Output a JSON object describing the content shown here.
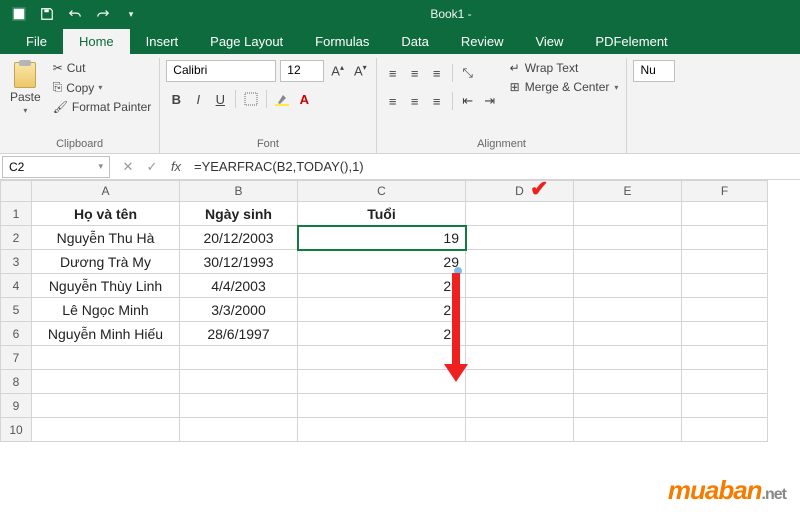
{
  "titlebar": {
    "doc_title": "Book1 -"
  },
  "tabs": [
    "File",
    "Home",
    "Insert",
    "Page Layout",
    "Formulas",
    "Data",
    "Review",
    "View",
    "PDFelement"
  ],
  "active_tab": 1,
  "clipboard": {
    "paste_label": "Paste",
    "cut_label": "Cut",
    "copy_label": "Copy",
    "fp_label": "Format Painter",
    "group_label": "Clipboard"
  },
  "font": {
    "name": "Calibri",
    "size": "12",
    "bold": "B",
    "italic": "I",
    "underline": "U",
    "group_label": "Font"
  },
  "alignment": {
    "wrap_label": "Wrap Text",
    "merge_label": "Merge & Center",
    "group_label": "Alignment"
  },
  "number": {
    "format": "Nu"
  },
  "formula_bar": {
    "name_box": "C2",
    "formula": "=YEARFRAC(B2,TODAY(),1)"
  },
  "columns": [
    "A",
    "B",
    "C",
    "D",
    "E",
    "F"
  ],
  "headers": {
    "A": "Họ và tên",
    "B": "Ngày sinh",
    "C": "Tuổi"
  },
  "rows": [
    {
      "A": "Nguyễn Thu Hà",
      "B": "20/12/2003",
      "C": "19"
    },
    {
      "A": "Dương Trà My",
      "B": "30/12/1993",
      "C": "29"
    },
    {
      "A": "Nguyễn Thùy Linh",
      "B": "4/4/2003",
      "C": "20"
    },
    {
      "A": "Lê Ngọc Minh",
      "B": "3/3/2000",
      "C": "23"
    },
    {
      "A": "Nguyễn Minh Hiếu",
      "B": "28/6/1997",
      "C": "26"
    }
  ],
  "watermark": {
    "brand": "muaban",
    "suffix": ".net"
  }
}
